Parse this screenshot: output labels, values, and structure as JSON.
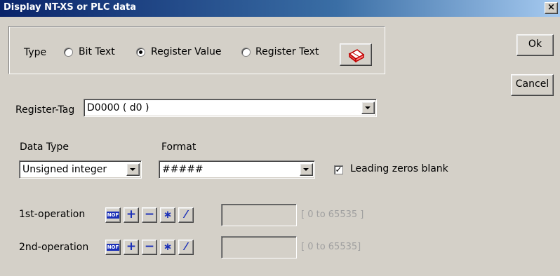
{
  "window": {
    "title": "Display NT-XS or PLC data",
    "close_glyph": "×"
  },
  "type": {
    "label": "Type",
    "options": [
      {
        "label": "Bit Text",
        "checked": false
      },
      {
        "label": "Register Value",
        "checked": true
      },
      {
        "label": "Register Text",
        "checked": false
      }
    ],
    "icon": "eraser-icon"
  },
  "buttons": {
    "ok": "Ok",
    "cancel": "Cancel"
  },
  "register": {
    "label": "Register-Tag",
    "value": "D0000 ( d0 )"
  },
  "data_type": {
    "label": "Data Type",
    "value": "Unsigned integer"
  },
  "format": {
    "label": "Format",
    "value": "#####"
  },
  "leading_zeros": {
    "label": "Leading zeros blank",
    "checked": true,
    "mark": "✓"
  },
  "operations": {
    "op_buttons": [
      "NOF",
      "+",
      "−",
      "∗",
      "⁄"
    ],
    "first": {
      "label": "1st-operation",
      "value": "",
      "range": "[ 0 to 65535 ]"
    },
    "second": {
      "label": "2nd-operation",
      "value": "",
      "range": "[ 0 to 65535]"
    }
  }
}
